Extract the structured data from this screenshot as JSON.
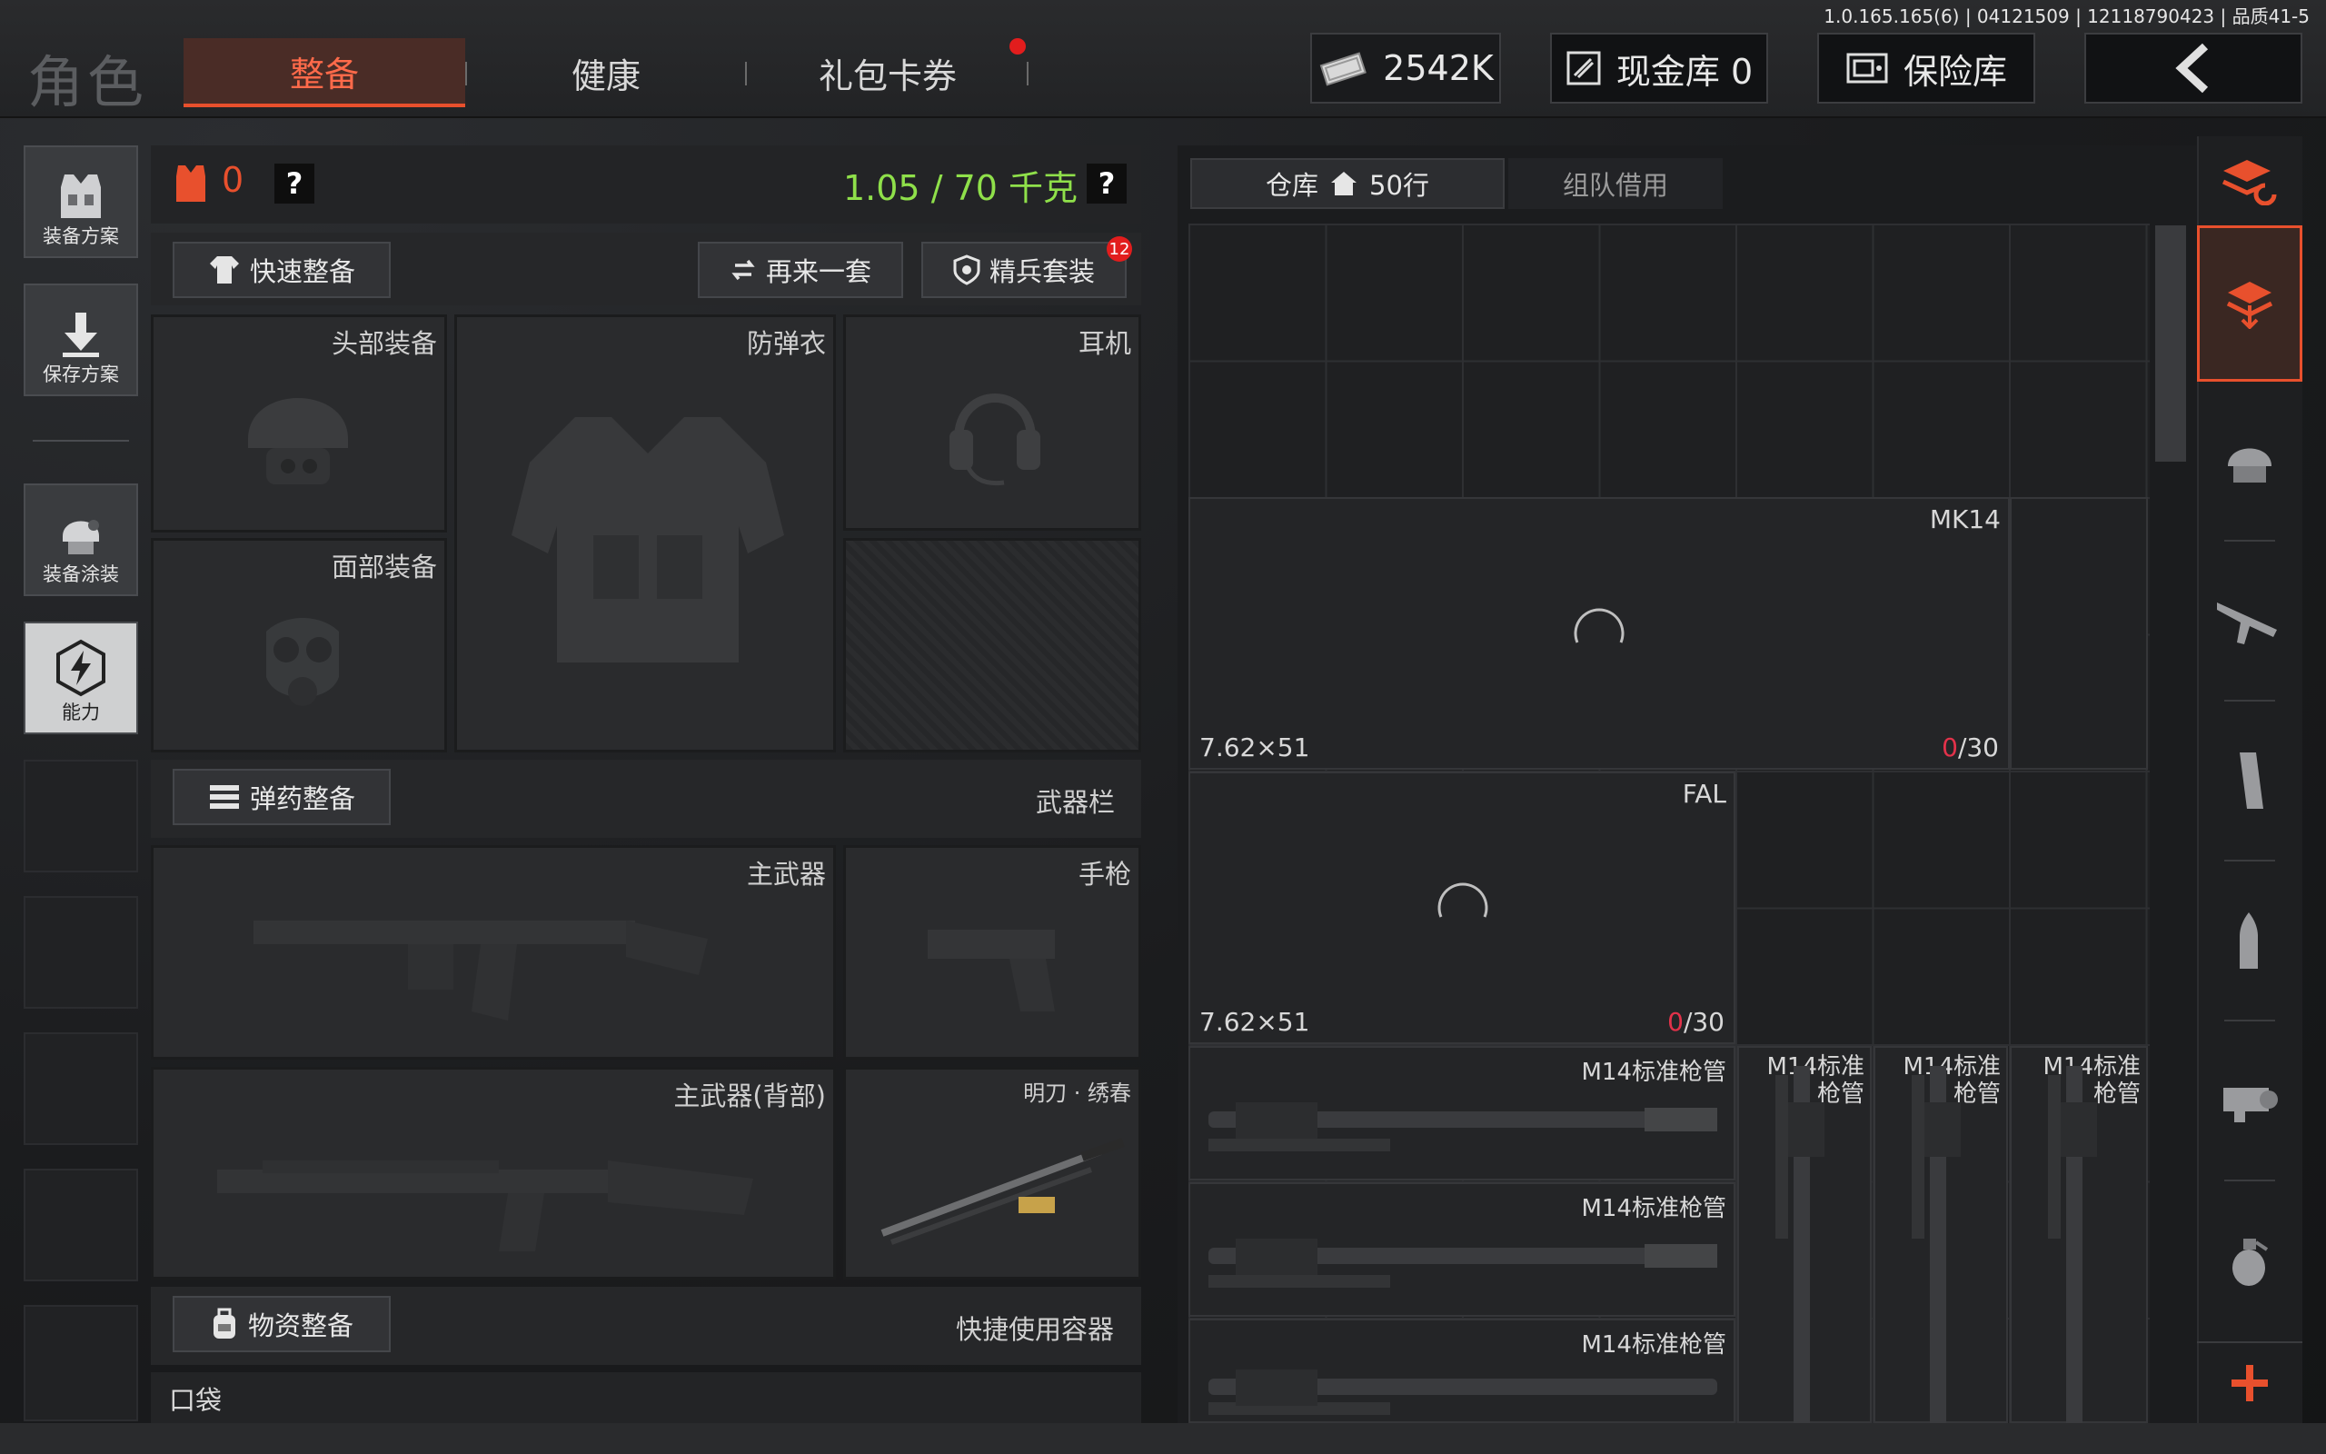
{
  "header": {
    "title": "角色",
    "tabs": [
      {
        "label": "整备",
        "active": true
      },
      {
        "label": "健康",
        "active": false
      },
      {
        "label": "礼包卡券",
        "active": false
      }
    ],
    "money": "2542K",
    "cash_vault": "现金库 0",
    "safe_vault": "保险库",
    "version_info": "1.0.165.165(6) | 04121509 | 12118790423 | 品质41-5"
  },
  "sidebar": {
    "items": [
      {
        "label": "装备方案",
        "icon": "vest-icon"
      },
      {
        "label": "保存方案",
        "icon": "download-icon"
      },
      {
        "label": "装备涂装",
        "icon": "helmet-paint-icon"
      },
      {
        "label": "能力",
        "icon": "lightning-icon"
      }
    ]
  },
  "loadout": {
    "armor_count": "0",
    "help": "?",
    "weight": "1.05 / 70 千克",
    "quick_equip": "快速整备",
    "again": "再来一套",
    "elite_set": "精兵套装",
    "elite_badge": "12",
    "slots": {
      "head": "头部装备",
      "body_armor": "防弹衣",
      "headset": "耳机",
      "face": "面部装备"
    },
    "ammo_section": "弹药整备",
    "weapon_bar": "武器栏",
    "weapons": {
      "primary": "主武器",
      "pistol": "手枪",
      "primary_back": "主武器(背部)",
      "melee": "明刀 · 绣春"
    },
    "supply_section": "物资整备",
    "quick_container": "快捷使用容器",
    "pocket": "口袋"
  },
  "storage": {
    "tab_warehouse": "仓库",
    "rows": "50行",
    "tab_team": "组队借用",
    "items": [
      {
        "name": "MK14",
        "caliber": "7.62×51",
        "count_current": "0",
        "count_max": "/30"
      },
      {
        "name": "FAL",
        "caliber": "7.62×51",
        "count_current": "0",
        "count_max": "/30"
      }
    ],
    "barrel_name": "M14标准枪管",
    "barrel_vertical_name": "M14标准枪管"
  },
  "colors": {
    "accent": "#e8502d",
    "weight_green": "#8fe04a",
    "count_red": "#e2324a"
  }
}
